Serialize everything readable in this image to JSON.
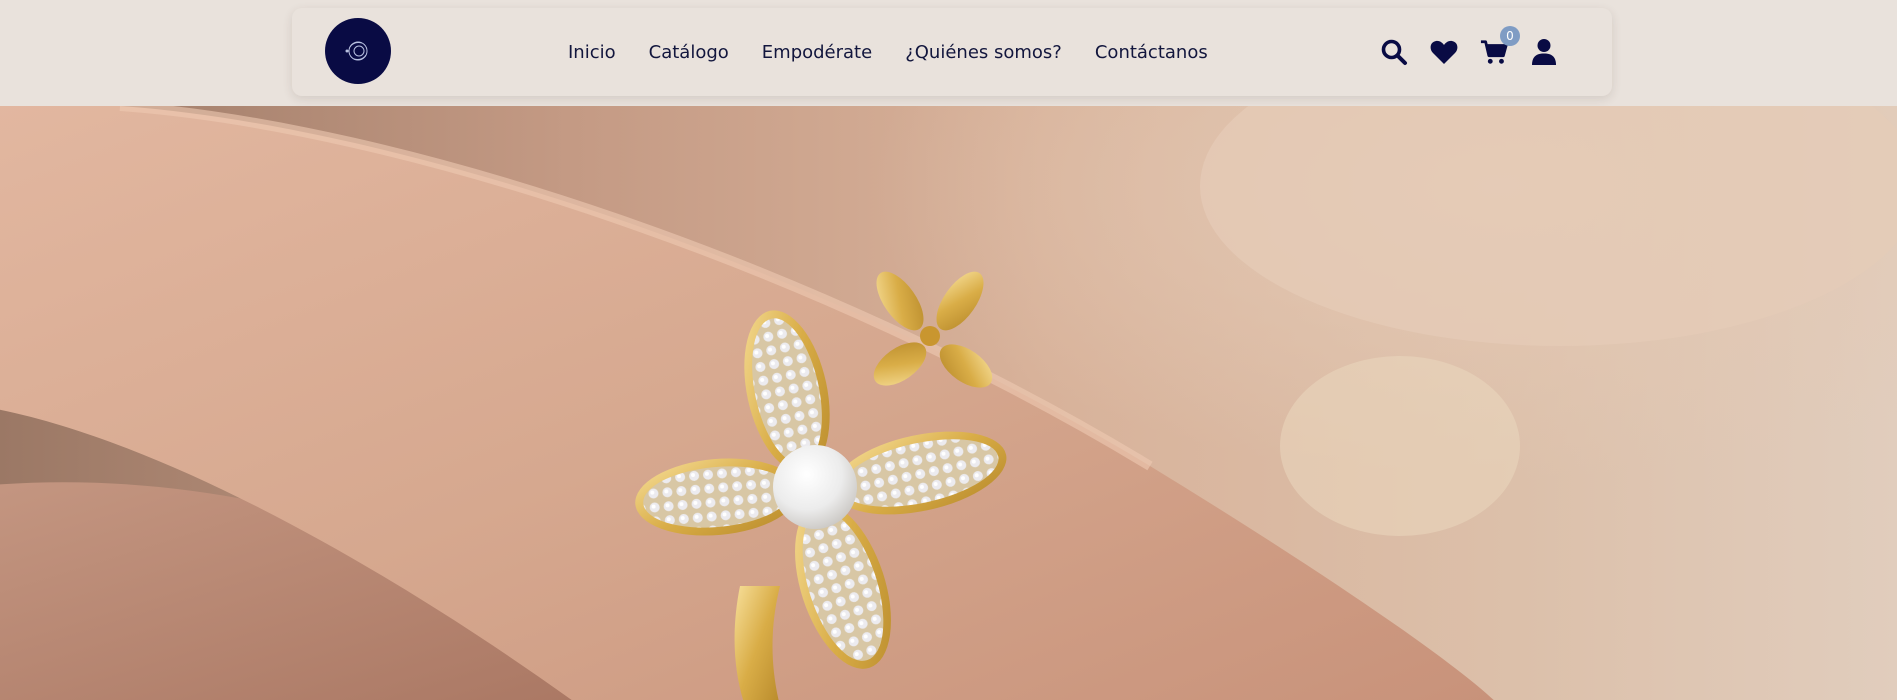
{
  "header": {
    "logo_alt": "logo",
    "nav": [
      {
        "label": "Inicio"
      },
      {
        "label": "Catálogo"
      },
      {
        "label": "Empodérate"
      },
      {
        "label": "¿Quiénes somos?"
      },
      {
        "label": "Contáctanos"
      }
    ],
    "icons": {
      "search": "search-icon",
      "wishlist": "heart-icon",
      "cart": "cart-icon",
      "account": "user-icon"
    },
    "cart_count": "0"
  },
  "hero": {
    "image_description": "hand-with-flower-ring"
  },
  "colors": {
    "background": "#e9e2dc",
    "navy": "#090b44",
    "text": "#12163d",
    "badge": "#7f9cc4"
  }
}
